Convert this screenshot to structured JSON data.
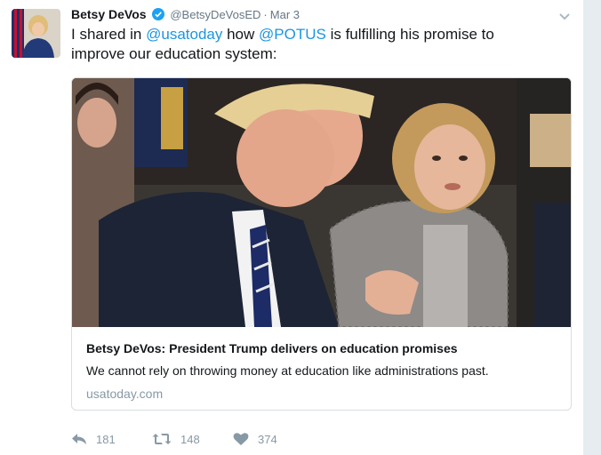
{
  "author": {
    "name": "Betsy DeVos",
    "handle": "@BetsyDeVosED",
    "separator": "·",
    "date": "Mar 3"
  },
  "tweet": {
    "segments": [
      {
        "text": "I shared in ",
        "type": "text"
      },
      {
        "text": "@usatoday",
        "type": "mention"
      },
      {
        "text": " how ",
        "type": "text"
      },
      {
        "text": "@POTUS",
        "type": "mention"
      },
      {
        "text": " is fulfilling his promise to improve our education system:",
        "type": "text"
      }
    ]
  },
  "card": {
    "title": "Betsy DeVos: President Trump delivers on education promises",
    "description": "We cannot rely on throwing money at education like administrations past.",
    "domain": "usatoday.com"
  },
  "actions": {
    "replies": "181",
    "retweets": "148",
    "likes": "374"
  },
  "colors": {
    "link": "#1b95e0",
    "muted": "#8899a6",
    "text": "#14171a"
  },
  "icons": [
    "verified-icon",
    "caret-down-icon",
    "reply-icon",
    "retweet-icon",
    "heart-icon"
  ]
}
